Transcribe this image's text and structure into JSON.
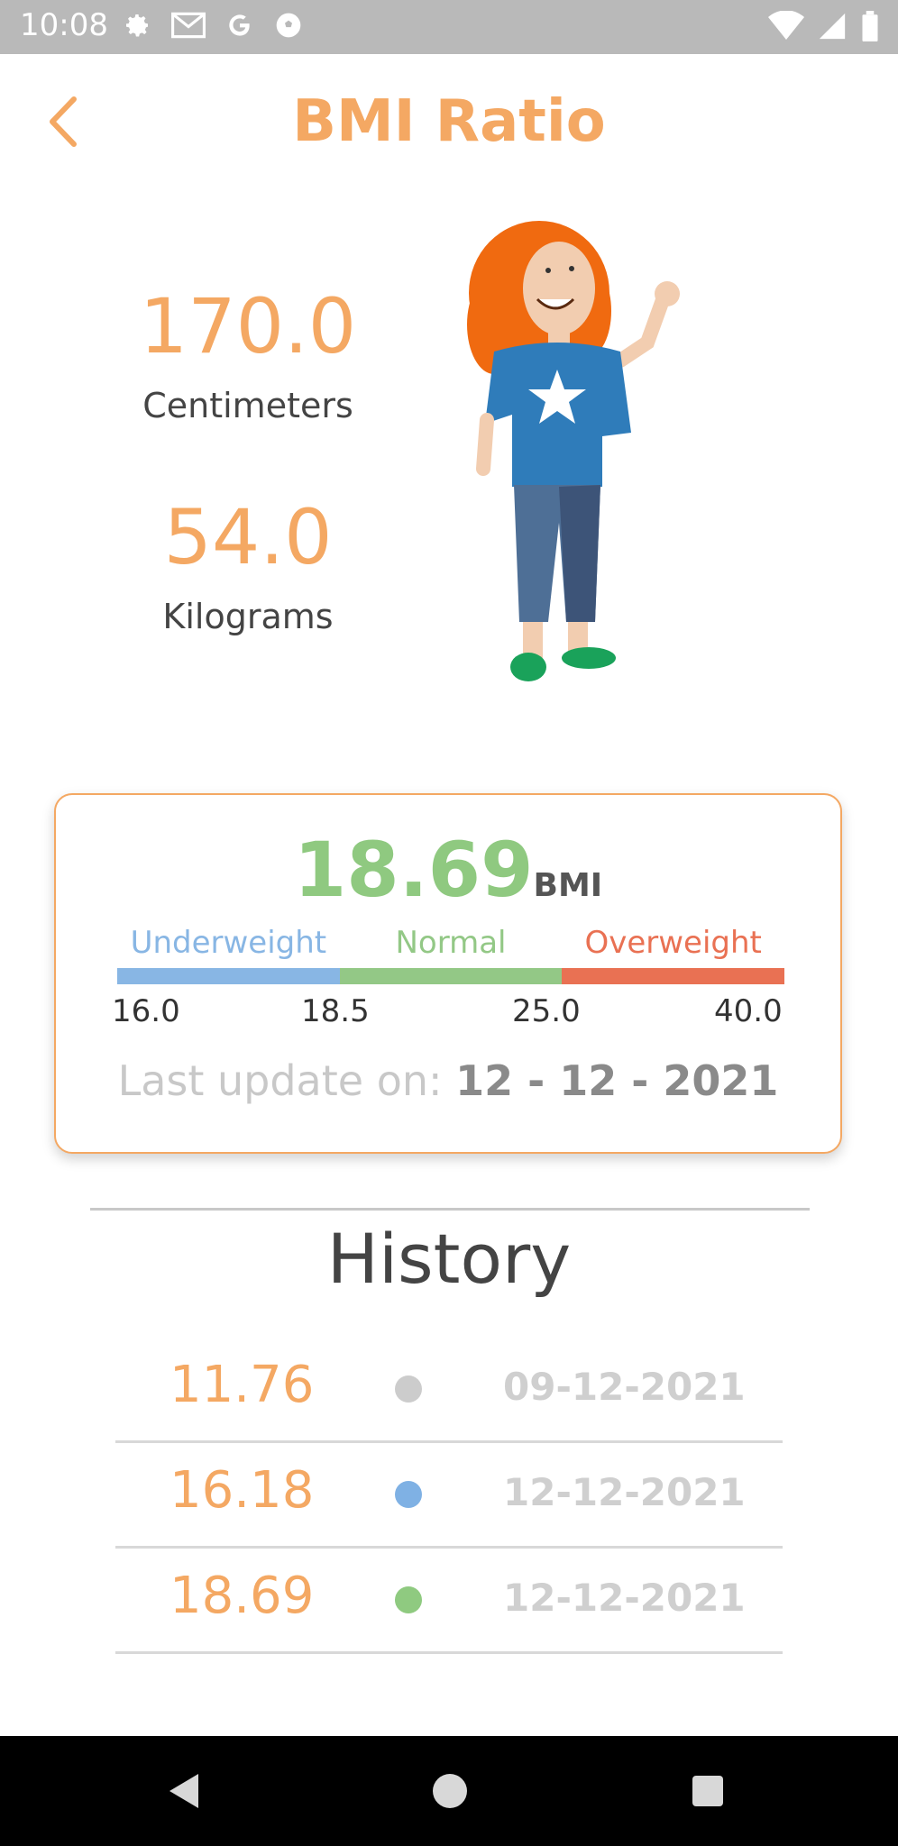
{
  "status_bar": {
    "time": "10:08",
    "icons_left": [
      "gear-icon",
      "gmail-icon",
      "google-icon",
      "soccer-ball-icon"
    ],
    "icons_right": [
      "wifi-icon",
      "signal-icon",
      "battery-icon"
    ]
  },
  "app_bar": {
    "title": "BMI Ratio",
    "back_icon": "chevron-left-icon"
  },
  "measurements": {
    "height_value": "170.0",
    "height_unit": "Centimeters",
    "weight_value": "54.0",
    "weight_unit": "Kilograms"
  },
  "bmi_card": {
    "value": "18.69",
    "unit": "BMI",
    "categories": [
      {
        "label": "Underweight",
        "color": "#88b6e4"
      },
      {
        "label": "Normal",
        "color": "#93c886"
      },
      {
        "label": "Overweight",
        "color": "#e97153"
      }
    ],
    "ticks": [
      "16.0",
      "18.5",
      "25.0",
      "40.0"
    ],
    "last_update_label": "Last update on:",
    "last_update_date": "12 - 12 - 2021"
  },
  "history": {
    "title": "History",
    "entries": [
      {
        "bmi": "11.76",
        "date": "09-12-2021",
        "dot_color": "#cccccc"
      },
      {
        "bmi": "16.18",
        "date": "12-12-2021",
        "dot_color": "#7fb1e4"
      },
      {
        "bmi": "18.69",
        "date": "12-12-2021",
        "dot_color": "#8fca80"
      }
    ]
  },
  "colors": {
    "accent": "#f4a863",
    "bmi_value": "#8fc980"
  },
  "nav_bar": {
    "buttons": [
      "back-triangle-icon",
      "home-circle-icon",
      "recents-square-icon"
    ]
  }
}
